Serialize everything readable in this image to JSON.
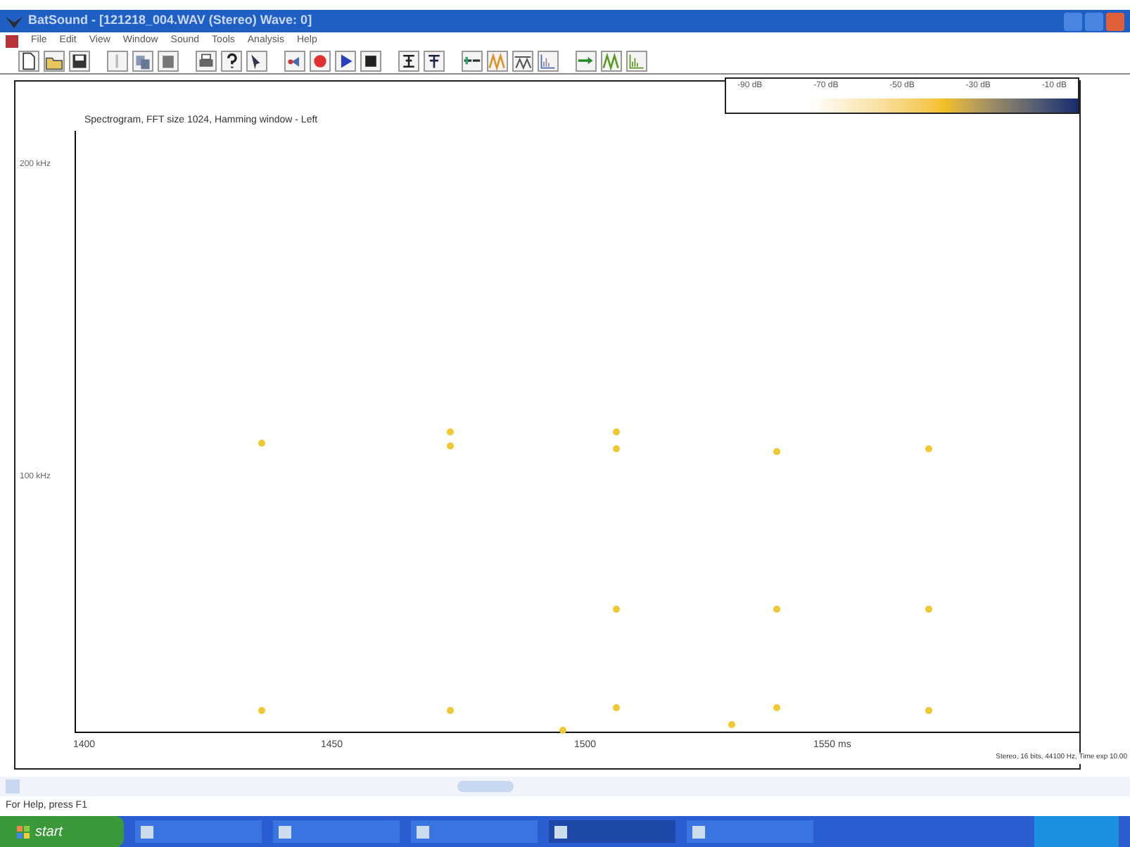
{
  "window": {
    "title": "BatSound - [121218_004.WAV (Stereo) Wave: 0]"
  },
  "menu": [
    "File",
    "Edit",
    "View",
    "Window",
    "Sound",
    "Tools",
    "Analysis",
    "Help"
  ],
  "plot": {
    "title": "Spectrogram, FFT size 1024, Hamming window - Left",
    "colorbar_labels": [
      "-90 dB",
      "-70 dB",
      "-50 dB",
      "-30 dB",
      "-10 dB"
    ],
    "y_labels": [
      "200 kHz",
      "100 kHz"
    ],
    "x_labels": [
      "1400",
      "1450",
      "1500",
      "1550 ms"
    ],
    "info": "Stereo, 16 bits, 44100 Hz, Time exp 10.00"
  },
  "status_bar": "For Help, press F1",
  "taskbar": {
    "start": "start"
  }
}
